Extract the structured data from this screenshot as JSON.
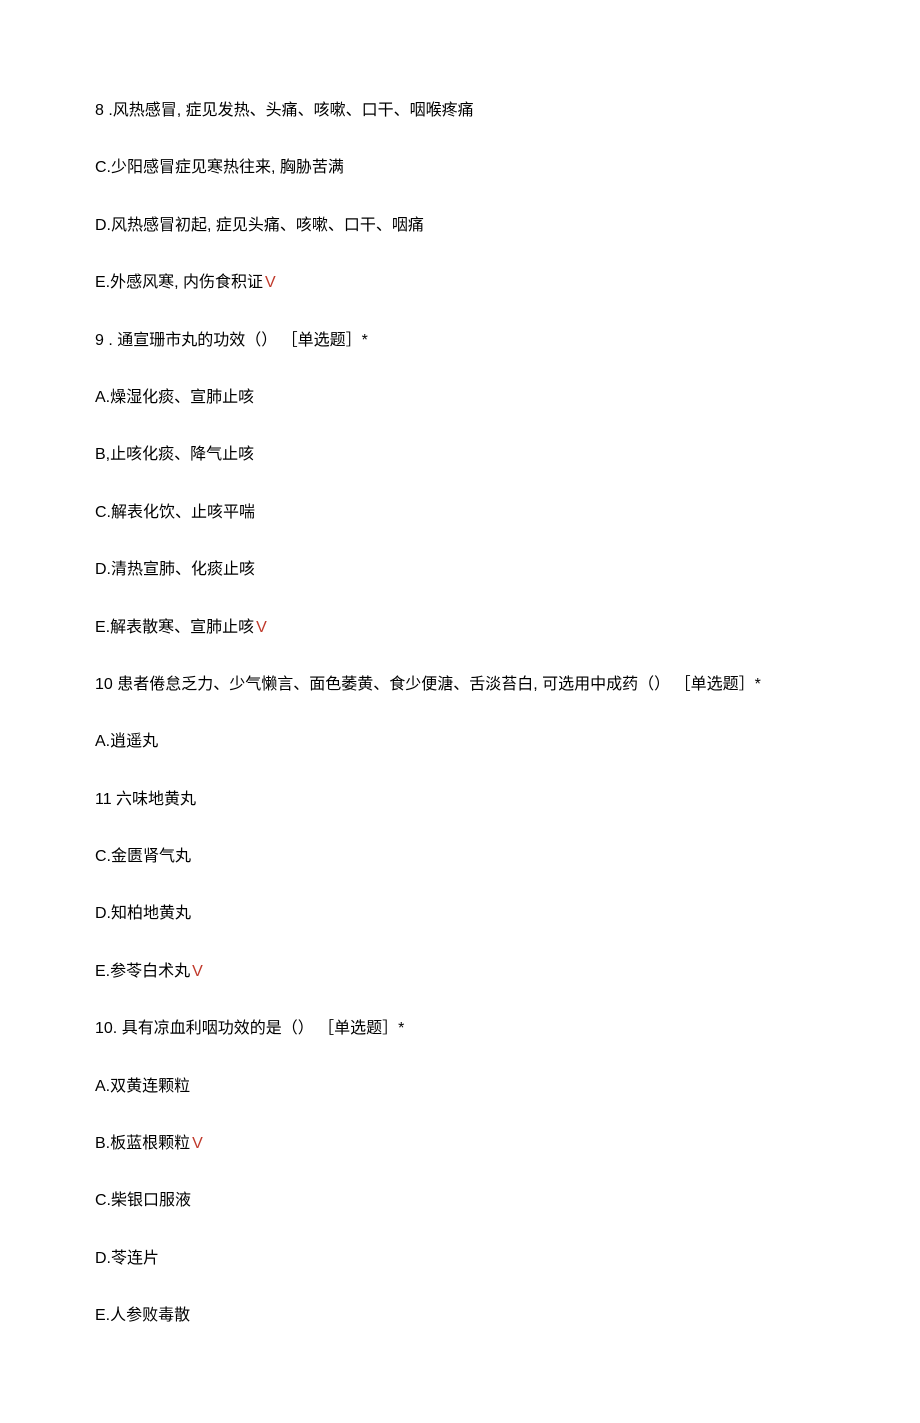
{
  "lines": [
    {
      "text": "8  .风热感冒, 症见发热、头痛、咳嗽、口干、咽喉疼痛",
      "check": false
    },
    {
      "text": "C.少阳感冒症见寒热往来, 胸胁苦满",
      "check": false
    },
    {
      "text": "D.风热感冒初起, 症见头痛、咳嗽、口干、咽痛",
      "check": false
    },
    {
      "text": "E.外感风寒, 内伤食积证",
      "check": true
    },
    {
      "text": "9  . 通宣珊市丸的功效（） ［单选题］*",
      "check": false
    },
    {
      "text": "A.燥湿化痰、宣肺止咳",
      "check": false
    },
    {
      "text": "B,止咳化痰、降气止咳",
      "check": false
    },
    {
      "text": "C.解表化饮、止咳平喘",
      "check": false
    },
    {
      "text": "D.清热宣肺、化痰止咳",
      "check": false
    },
    {
      "text": "E.解表散寒、宣肺止咳",
      "check": true
    },
    {
      "text": "10  患者倦怠乏力、少气懒言、面色萎黄、食少便溏、舌淡苔白, 可选用中成药（） ［单选题］*",
      "check": false
    },
    {
      "text": "A.逍遥丸",
      "check": false
    },
    {
      "text": "11  六味地黄丸",
      "check": false
    },
    {
      "text": "C.金匮肾气丸",
      "check": false
    },
    {
      "text": "D.知柏地黄丸",
      "check": false
    },
    {
      "text": "E.参苓白术丸",
      "check": true
    },
    {
      "text": "10. 具有凉血利咽功效的是（） ［单选题］*",
      "check": false
    },
    {
      "text": "A.双黄连颗粒",
      "check": false
    },
    {
      "text": "B.板蓝根颗粒",
      "check": true
    },
    {
      "text": "C.柴银口服液",
      "check": false
    },
    {
      "text": "D.苓连片",
      "check": false
    },
    {
      "text": "E.人参败毒散",
      "check": false
    }
  ],
  "checkMark": "V"
}
